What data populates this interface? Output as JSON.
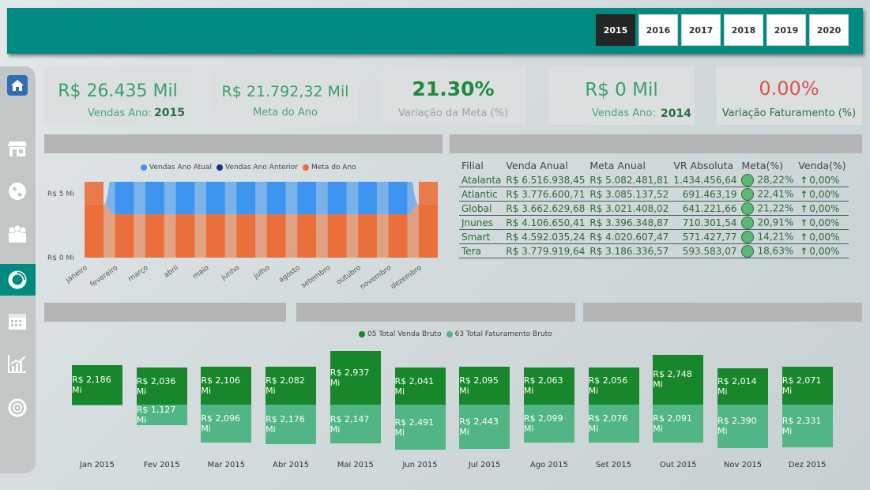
{
  "years": [
    {
      "label": "2015",
      "active": true
    },
    {
      "label": "2016",
      "active": false
    },
    {
      "label": "2017",
      "active": false
    },
    {
      "label": "2018",
      "active": false
    },
    {
      "label": "2019",
      "active": false
    },
    {
      "label": "2020",
      "active": false
    }
  ],
  "nav_icons": [
    "home-icon",
    "store-icon",
    "globe-icon",
    "people-icon",
    "donut-icon",
    "calendar-icon",
    "chart-icon",
    "target-icon"
  ],
  "kpis": {
    "vendas_ano": {
      "value": "R$ 26.435 Mil",
      "label": "Vendas Ano:",
      "year": "2015"
    },
    "meta_ano": {
      "value": "R$ 21.792,32 Mil",
      "label": "Meta do Ano"
    },
    "variacao_meta": {
      "value": "21.30%",
      "label": "Variação da Meta (%)"
    },
    "vendas_ano_anterior": {
      "value": "R$ 0 Mil",
      "label": "Vendas Ano:",
      "year": "2014"
    },
    "variacao_faturamento": {
      "value": "0.00%",
      "label": "Variação Faturamento (%)"
    }
  },
  "colors": {
    "teal": "#008a82",
    "dark_green": "#18862b",
    "light_green": "#52b585",
    "blue": "#3d95f0",
    "orange": "#ea6f3b",
    "navy": "#1f2d8a",
    "red": "#d9534f"
  },
  "chart_data": [
    {
      "type": "area",
      "title": "",
      "legend": [
        "Vendas Ano Atual",
        "Vendas Ano Anterior",
        "Meta do Ano"
      ],
      "legend_position": "top-center",
      "y_ticks": [
        "R$ 5 Mi",
        "R$ 0 Mi"
      ],
      "ylim": [
        0,
        5
      ],
      "categories": [
        "janeiro",
        "fevereiro",
        "março",
        "abril",
        "maio",
        "junho",
        "julho",
        "agosto",
        "setembro",
        "outubro",
        "novembro",
        "dezembro"
      ],
      "series": [
        {
          "name": "Vendas Ano Atual",
          "values": [
            0,
            2.2,
            2.0,
            2.1,
            2.1,
            2.9,
            2.0,
            2.1,
            2.1,
            2.7,
            2.0,
            0
          ]
        },
        {
          "name": "Vendas Ano Anterior",
          "values": [
            0,
            0,
            0,
            0,
            0,
            0,
            0,
            0,
            0,
            0,
            0,
            0
          ]
        },
        {
          "name": "Meta do Ano",
          "values": [
            2.2,
            1.8,
            1.8,
            1.8,
            1.8,
            1.8,
            1.8,
            1.8,
            1.8,
            1.8,
            1.8,
            2.2
          ]
        }
      ]
    },
    {
      "type": "bar",
      "legend": [
        "05 Total Venda Bruto",
        "63 Total Faturamento Bruto"
      ],
      "categories": [
        "Jan 2015",
        "Fev 2015",
        "Mar 2015",
        "Abr 2015",
        "Mai 2015",
        "Jun 2015",
        "Jul 2015",
        "Ago 2015",
        "Set 2015",
        "Out 2015",
        "Nov 2015",
        "Dez 2015"
      ],
      "series": [
        {
          "name": "05 Total Venda Bruto",
          "values": [
            2.186,
            2.036,
            2.106,
            2.082,
            2.937,
            2.041,
            2.095,
            2.063,
            2.056,
            2.748,
            2.014,
            2.071
          ],
          "labels": [
            "R$ 2,186 Mi",
            "R$ 2,036 Mi",
            "R$ 2,106 Mi",
            "R$ 2,082 Mi",
            "R$ 2,937 Mi",
            "R$ 2,041 Mi",
            "R$ 2,095 Mi",
            "R$ 2,063 Mi",
            "R$ 2,056 Mi",
            "R$ 2,748 Mi",
            "R$ 2,014 Mi",
            "R$ 2,071 Mi"
          ]
        },
        {
          "name": "63 Total Faturamento Bruto",
          "values": [
            0,
            1.127,
            2.096,
            2.176,
            2.147,
            2.491,
            2.443,
            2.099,
            2.076,
            2.091,
            2.39,
            2.331
          ],
          "labels": [
            "",
            "R$ 1,127 Mi",
            "R$ 2,096 Mi",
            "R$ 2,176 Mi",
            "R$ 2,147 Mi",
            "R$ 2,491 Mi",
            "R$ 2,443 Mi",
            "R$ 2,099 Mi",
            "R$ 2,076 Mi",
            "R$ 2,091 Mi",
            "R$ 2,390 Mi",
            "R$ 2,331 Mi"
          ]
        }
      ]
    }
  ],
  "table": {
    "headers": [
      "Filial",
      "Venda Anual",
      "Meta Anual",
      "VR Absoluta",
      "Meta(%)",
      "Venda(%)"
    ],
    "rows": [
      [
        "Atalanta",
        "R$ 6.516.938,45",
        "R$ 5.082.481,81",
        "1.434.456,64",
        "28,22%",
        "0,00%"
      ],
      [
        "Atlantic",
        "R$ 3.776.600,71",
        "R$ 3.085.137,52",
        "691.463,19",
        "22,41%",
        "0,00%"
      ],
      [
        "Global",
        "R$ 3.662.629,68",
        "R$ 3.021.408,02",
        "641.221,66",
        "21,22%",
        "0,00%"
      ],
      [
        "Jnunes",
        "R$ 4.106.650,41",
        "R$ 3.396.348,87",
        "710.301,54",
        "20,91%",
        "0,00%"
      ],
      [
        "Smart",
        "R$ 4.592.035,24",
        "R$ 4.020.607,47",
        "571.427,77",
        "14,21%",
        "0,00%"
      ],
      [
        "Tera",
        "R$ 3.779.919,64",
        "R$ 3.186.336,57",
        "593.583,07",
        "18,63%",
        "0,00%"
      ]
    ]
  }
}
